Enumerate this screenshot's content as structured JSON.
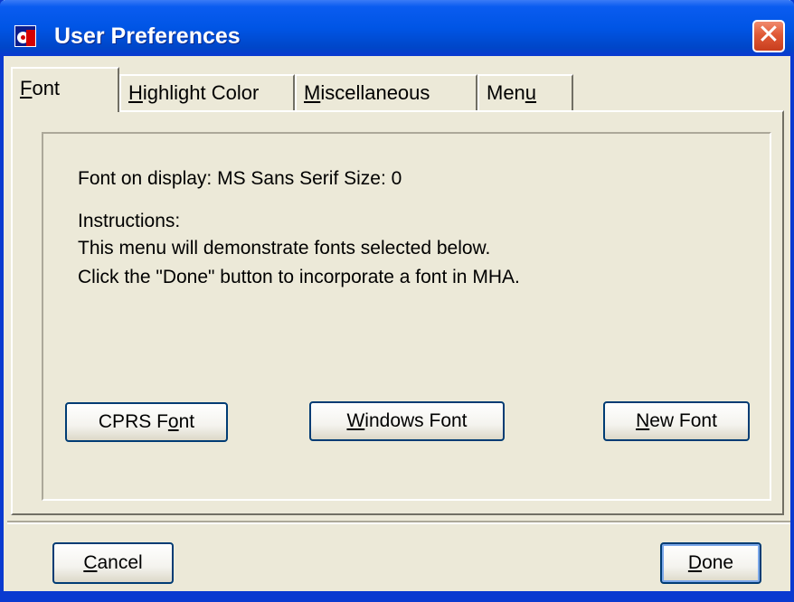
{
  "window": {
    "title": "User Preferences"
  },
  "tabs": [
    {
      "pre": "",
      "key": "F",
      "post": "ont"
    },
    {
      "pre": "",
      "key": "H",
      "post": "ighlight Color"
    },
    {
      "pre": "",
      "key": "M",
      "post": "iscellaneous"
    },
    {
      "pre": "Men",
      "key": "u",
      "post": ""
    }
  ],
  "font_tab": {
    "font_display_label": "Font on display: MS Sans Serif   Size: 0",
    "instructions_heading": "Instructions:",
    "instruction_line_1": "This menu will demonstrate fonts selected below.",
    "instruction_line_2": "Click the \"Done\" button to incorporate a font in MHA.",
    "buttons": {
      "cprs": {
        "pre": "CPRS F",
        "key": "o",
        "post": "nt"
      },
      "windows": {
        "pre": "",
        "key": "W",
        "post": "indows Font"
      },
      "new": {
        "pre": "",
        "key": "N",
        "post": "ew Font"
      }
    }
  },
  "footer": {
    "cancel": {
      "pre": "",
      "key": "C",
      "post": "ancel"
    },
    "done": {
      "pre": "",
      "key": "D",
      "post": "one"
    }
  },
  "colors": {
    "titlebar": "#0055e5",
    "window_face": "#ece9d8",
    "close_button": "#e05a36",
    "button_border": "#003c74"
  },
  "icons": {
    "app": "mha-app-icon",
    "close": "close-icon"
  }
}
